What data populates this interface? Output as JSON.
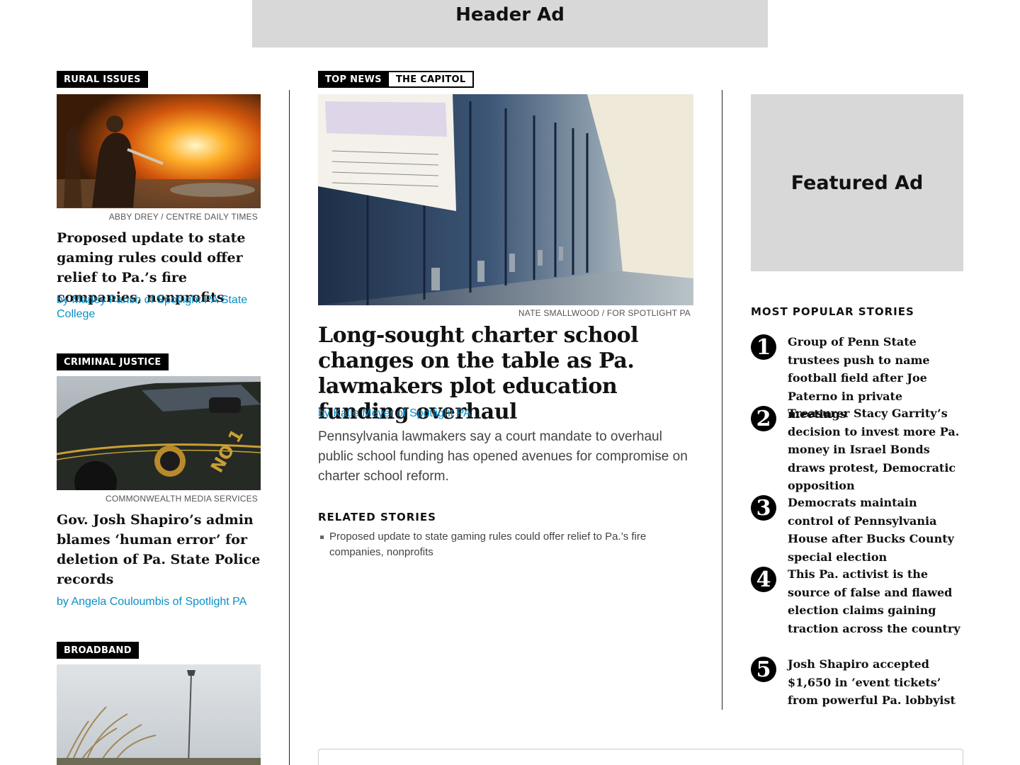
{
  "ads": {
    "header": "Header Ad",
    "featured": "Featured Ad"
  },
  "left_column": [
    {
      "tag": "RURAL ISSUES",
      "photo_desc": "firefighter-photo",
      "credit": "ABBY DREY / CENTRE DAILY TIMES",
      "headline": "Proposed update to state gaming rules could offer relief to Pa.’s fire companies, nonprofits",
      "byline": "by Marley Parish of Spotlight PA State College"
    },
    {
      "tag": "CRIMINAL JUSTICE",
      "photo_desc": "police-car-photo",
      "credit": "COMMONWEALTH MEDIA SERVICES",
      "headline": "Gov. Josh Shapiro’s admin blames ‘human error’ for deletion of Pa. State Police records",
      "byline": "by Angela Couloumbis of Spotlight PA"
    },
    {
      "tag": "BROADBAND",
      "photo_desc": "tower-field-photo"
    }
  ],
  "main_story": {
    "tag_primary": "TOP NEWS",
    "tag_secondary": "THE CAPITOL",
    "credit": "NATE SMALLWOOD / FOR SPOTLIGHT PA",
    "headline": "Long-sought charter school changes on the table as Pa. lawmakers plot education funding overhaul",
    "byline": "by Katie Meyer of Spotlight PA",
    "dek": "Pennsylvania lawmakers say a court mandate to overhaul public school funding has opened avenues for compromise on charter school reform.",
    "related_label": "RELATED STORIES",
    "related": [
      "Proposed update to state gaming rules could offer relief to Pa.’s fire companies, nonprofits"
    ]
  },
  "most_popular": {
    "label": "MOST POPULAR STORIES",
    "items": [
      {
        "num": "1",
        "title": "Group of Penn State trustees push to name football field after Joe Paterno in private meetings"
      },
      {
        "num": "2",
        "title": "Treasurer Stacy Garrity’s decision to invest more Pa. money in Israel Bonds draws protest, Democratic opposition"
      },
      {
        "num": "3",
        "title": "Democrats maintain control of Pennsylvania House after Bucks County special election"
      },
      {
        "num": "4",
        "title": "This Pa. activist is the source of false and flawed election claims gaining traction across the country"
      },
      {
        "num": "5",
        "title": "Josh Shapiro accepted $1,650 in ‘event tickets’ from powerful Pa. lobbyist"
      }
    ]
  },
  "colors": {
    "link": "#0a8fc7",
    "ad_bg": "#d8d8d8",
    "tag_bg": "#000000"
  }
}
